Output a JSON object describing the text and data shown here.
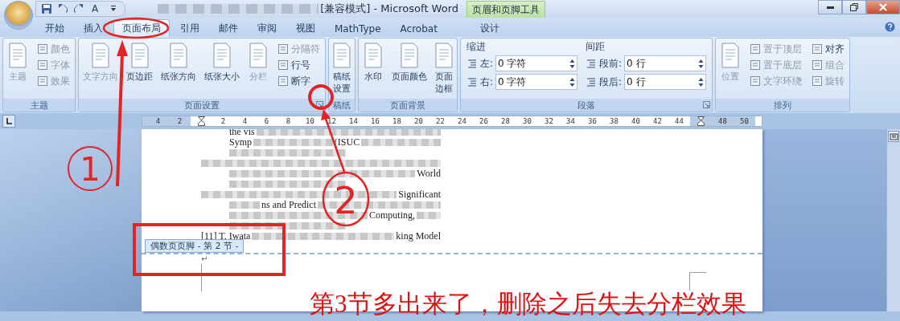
{
  "window": {
    "qat_letter": "A",
    "title": "[兼容模式] - Microsoft Word",
    "context_tab": "页眉和页脚工具"
  },
  "tabs": [
    {
      "label": "开始",
      "selected": false,
      "kind": "main"
    },
    {
      "label": "插入",
      "selected": false,
      "kind": "main"
    },
    {
      "label": "页面布局",
      "selected": true,
      "kind": "main"
    },
    {
      "label": "引用",
      "selected": false,
      "kind": "main"
    },
    {
      "label": "邮件",
      "selected": false,
      "kind": "main"
    },
    {
      "label": "审阅",
      "selected": false,
      "kind": "main"
    },
    {
      "label": "视图",
      "selected": false,
      "kind": "main"
    },
    {
      "label": "MathType",
      "selected": false,
      "kind": "main"
    },
    {
      "label": "Acrobat",
      "selected": false,
      "kind": "main"
    },
    {
      "label": "设计",
      "selected": false,
      "kind": "context"
    }
  ],
  "ribbon": {
    "groups": [
      {
        "label": "主题",
        "kind": "buttons",
        "launcher": false,
        "items": [
          {
            "kind": "large",
            "label": "主题",
            "disabled": true
          },
          {
            "kind": "column",
            "items": [
              {
                "label": "颜色",
                "disabled": true
              },
              {
                "label": "字体",
                "disabled": true
              },
              {
                "label": "效果",
                "disabled": true
              }
            ]
          }
        ]
      },
      {
        "label": "页面设置",
        "kind": "buttons",
        "launcher": true,
        "items": [
          {
            "kind": "large",
            "label": "文字方向",
            "disabled": true
          },
          {
            "kind": "large",
            "label": "页边距",
            "disabled": false
          },
          {
            "kind": "large",
            "label": "纸张方向",
            "disabled": false
          },
          {
            "kind": "large",
            "label": "纸张大小",
            "disabled": false
          },
          {
            "kind": "large",
            "label": "分栏",
            "disabled": true
          },
          {
            "kind": "column",
            "items": [
              {
                "label": "分隔符",
                "disabled": true
              },
              {
                "label": "行号",
                "disabled": false
              },
              {
                "label": "断字",
                "disabled": false
              }
            ]
          }
        ]
      },
      {
        "label": "稿纸",
        "kind": "buttons",
        "launcher": false,
        "items": [
          {
            "kind": "large",
            "label": "稿纸设置",
            "disabled": false
          }
        ]
      },
      {
        "label": "页面背景",
        "kind": "buttons",
        "launcher": false,
        "items": [
          {
            "kind": "large",
            "label": "水印",
            "disabled": false
          },
          {
            "kind": "large",
            "label": "页面颜色",
            "disabled": false
          },
          {
            "kind": "large",
            "label": "页面边框",
            "disabled": false
          }
        ]
      },
      {
        "label": "段落",
        "kind": "paragraph",
        "launcher": true,
        "columns": [
          {
            "heading": "缩进",
            "fields": [
              {
                "label": "左:",
                "value": "0 字符"
              },
              {
                "label": "右:",
                "value": "0 字符"
              }
            ]
          },
          {
            "heading": "间距",
            "fields": [
              {
                "label": "段前:",
                "value": "0 行"
              },
              {
                "label": "段后:",
                "value": "0 行"
              }
            ]
          }
        ]
      },
      {
        "label": "排列",
        "kind": "buttons",
        "launcher": false,
        "items": [
          {
            "kind": "large",
            "label": "位置",
            "disabled": true
          },
          {
            "kind": "column",
            "items": [
              {
                "label": "置于顶层",
                "disabled": true
              },
              {
                "label": "置于底层",
                "disabled": true
              },
              {
                "label": "文字环绕",
                "disabled": true
              }
            ]
          },
          {
            "kind": "column",
            "items": [
              {
                "label": "对齐",
                "disabled": false
              },
              {
                "label": "组合",
                "disabled": true
              },
              {
                "label": "旋转",
                "disabled": true
              }
            ]
          }
        ]
      }
    ]
  },
  "ruler": {
    "left_margin_labels": [
      "4",
      "2"
    ],
    "labels": [
      "2",
      "4",
      "6",
      "8",
      "10",
      "12",
      "14",
      "16",
      "18",
      "20",
      "22",
      "24",
      "26",
      "28",
      "30",
      "32",
      "34",
      "36",
      "38",
      "40",
      "42",
      "44"
    ],
    "right_margin_labels": [
      "48",
      "50"
    ]
  },
  "document": {
    "lines": [
      {
        "hanging": false,
        "parts": [
          {
            "kind": "text",
            "text": "the vis"
          },
          {
            "kind": "blur"
          }
        ]
      },
      {
        "hanging": false,
        "parts": [
          {
            "kind": "text",
            "text": "Symp"
          },
          {
            "kind": "blur"
          },
          {
            "kind": "text",
            "text": "(ISUC"
          },
          {
            "kind": "blur"
          }
        ]
      },
      {
        "hanging": false,
        "parts": [
          {
            "kind": "blur_short"
          }
        ]
      },
      {
        "hanging": true,
        "parts": [
          {
            "kind": "blur"
          }
        ]
      },
      {
        "hanging": false,
        "parts": [
          {
            "kind": "blur"
          },
          {
            "kind": "text",
            "text": "World"
          }
        ]
      },
      {
        "hanging": false,
        "parts": [
          {
            "kind": "blur_short"
          }
        ]
      },
      {
        "hanging": true,
        "parts": [
          {
            "kind": "blur"
          },
          {
            "kind": "text",
            "text": "Significant"
          }
        ]
      },
      {
        "hanging": false,
        "parts": [
          {
            "kind": "blur"
          },
          {
            "kind": "text",
            "text": "ns and Predict"
          },
          {
            "kind": "blur"
          }
        ]
      },
      {
        "hanging": false,
        "parts": [
          {
            "kind": "blur"
          },
          {
            "kind": "text",
            "text": "Computing,"
          },
          {
            "kind": "blur"
          }
        ]
      },
      {
        "hanging": false,
        "parts": [
          {
            "kind": "blur_short"
          }
        ]
      },
      {
        "hanging": true,
        "parts": [
          {
            "kind": "text",
            "text": "[11] T. Iwata"
          },
          {
            "kind": "blur"
          },
          {
            "kind": "text",
            "text": "king Model"
          }
        ]
      }
    ],
    "footer_tag": "偶数页页脚 - 第 2 节 -",
    "paragraph_mark": "↵"
  },
  "annotations": {
    "numbers": [
      "1",
      "2"
    ],
    "caption": "第3节多出来了，删除之后失去分栏效果"
  }
}
